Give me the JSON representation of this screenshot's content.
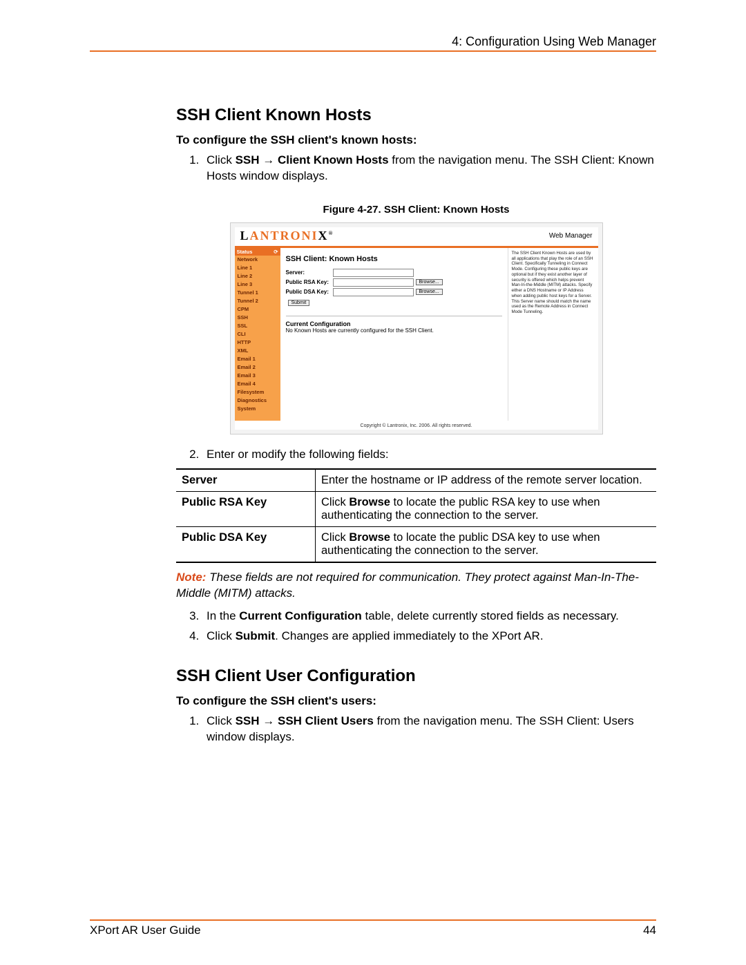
{
  "header": {
    "chapter": "4: Configuration Using Web Manager"
  },
  "section1": {
    "title": "SSH Client Known Hosts",
    "subhead": "To configure the SSH client's known hosts:",
    "step1_prefix": "Click ",
    "step1_bold1": "SSH",
    "step1_arrow": " → ",
    "step1_bold2": "Client Known Hosts",
    "step1_rest": " from the navigation menu. The SSH Client: Known Hosts window displays.",
    "figure_caption": "Figure 4-27. SSH Client: Known Hosts",
    "step2": "Enter or modify the following fields:",
    "table": [
      {
        "k": "Server",
        "v": "Enter the hostname or IP address of the remote server location."
      },
      {
        "k": "Public RSA Key",
        "v_pre": "Click ",
        "v_bold": "Browse",
        "v_post": " to locate the public RSA key to use when authenticating the connection to the server."
      },
      {
        "k": "Public DSA Key",
        "v_pre": "Click ",
        "v_bold": "Browse",
        "v_post": " to locate the public DSA key to use when authenticating the connection to the server."
      }
    ],
    "note_label": "Note:",
    "note_text": " These fields are not required for communication. They protect against Man-In-The-Middle (MITM) attacks.",
    "step3_pre": "In the ",
    "step3_bold": "Current Configuration",
    "step3_post": " table, delete currently stored fields as necessary.",
    "step4_pre": "Click ",
    "step4_bold": "Submit",
    "step4_post": ". Changes are applied immediately to the XPort AR."
  },
  "section2": {
    "title": "SSH Client User Configuration",
    "subhead": "To configure the SSH client's users:",
    "step1_prefix": "Click ",
    "step1_bold1": "SSH",
    "step1_arrow": " → ",
    "step1_bold2": "SSH Client Users",
    "step1_rest": " from the navigation menu. The SSH Client: Users window displays."
  },
  "screenshot": {
    "logo_l": "L",
    "logo_antroni": "ANTRONI",
    "logo_x": "X",
    "logo_tm": "®",
    "web_manager": "Web Manager",
    "nav": [
      "Status",
      "Network",
      "Line 1",
      "Line 2",
      "Line 3",
      "Tunnel 1",
      "Tunnel 2",
      "CPM",
      "SSH",
      "SSL",
      "CLI",
      "HTTP",
      "XML",
      "Email 1",
      "Email 2",
      "Email 3",
      "Email 4",
      "Filesystem",
      "Diagnostics",
      "System"
    ],
    "status_icon": "⟳",
    "panel_title": "SSH Client: Known Hosts",
    "server_label": "Server:",
    "rsa_label": "Public RSA Key:",
    "dsa_label": "Public DSA Key:",
    "browse": "Browse...",
    "submit": "Submit",
    "current_config": "Current Configuration",
    "no_hosts": "No Known Hosts are currently configured for the SSH Client.",
    "help_text": "The SSH Client Known Hosts are used by all applications that play the role of an SSH Client. Specifically Tunneling in Connect Mode. Configuring these public keys are optional but if they exist another layer of security is offered which helps prevent Man-In-the-Middle (MITM) attacks.\nSpecify either a DNS Hostname or IP Address when adding public host keys for a Server. This Server name should match the name used as the Remote Address in Connect Mode Tunneling.",
    "copyright": "Copyright © Lantronix, Inc. 2006. All rights reserved."
  },
  "footer": {
    "guide": "XPort AR User Guide",
    "page": "44"
  }
}
